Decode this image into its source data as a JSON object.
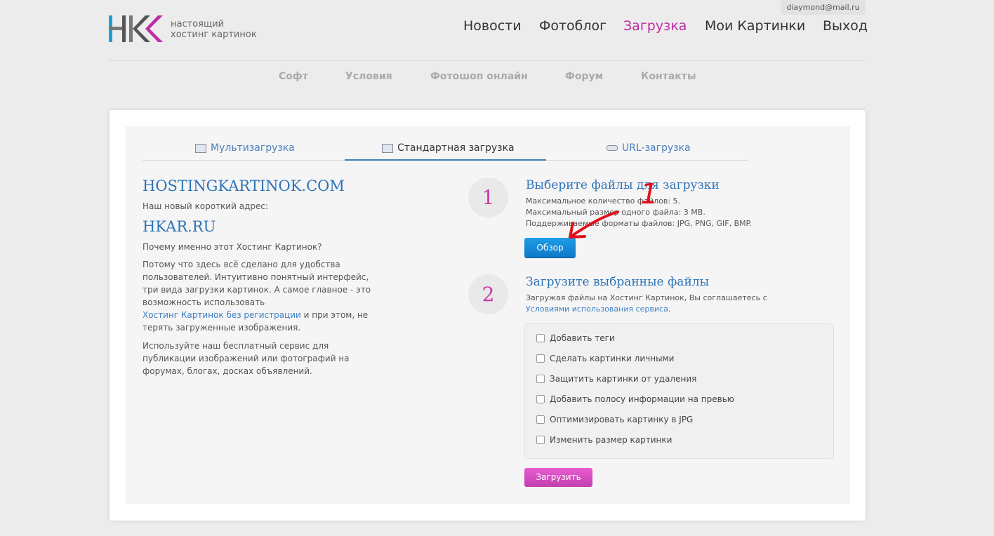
{
  "header": {
    "user_email": "diaymond@mail.ru",
    "tagline_line1": "настоящий",
    "tagline_line2": "хостинг картинок",
    "main_nav": [
      {
        "label": "Новости"
      },
      {
        "label": "Фотоблог"
      },
      {
        "label": "Загрузка"
      },
      {
        "label": "Мои Картинки"
      },
      {
        "label": "Выход"
      }
    ],
    "sub_nav": [
      {
        "label": "Софт"
      },
      {
        "label": "Условия"
      },
      {
        "label": "Фотошоп онлайн"
      },
      {
        "label": "Форум"
      },
      {
        "label": "Контакты"
      }
    ],
    "active_color": "#c02ca5"
  },
  "tabs": [
    {
      "label": "Мультизагрузка"
    },
    {
      "label": "Стандартная загрузка"
    },
    {
      "label": "URL-загрузка"
    }
  ],
  "left": {
    "site_name": "HOSTINGKARTINOK.COM",
    "short_address_label": "Наш новый короткий адрес:",
    "short_name": "HKAR.RU",
    "why_question": "Почему именно этот Хостинг Картинок?",
    "para1_line1": "Потому что здесь всё сделано для удобства",
    "para1_line2": "пользователей. Интуитивно понятный интерфейс,",
    "para1_line3": "три вида загрузки картинок. А самое главное - это",
    "para1_line4": "возможность использовать",
    "para1_link": "Хостинг Картинок без регистрации",
    "para1_after_link": " и при этом, не",
    "para1_line6": "терять загруженные изображения.",
    "para2_line1": "Используйте наш бесплатный сервис для",
    "para2_line2": "публикации изображений или фотографий на",
    "para2_line3": "форумах, блогах, досках объявлений."
  },
  "step1": {
    "number": "1",
    "title": "Выберите файлы для загрузки",
    "max_files": "Максимальное количество файлов: 5.",
    "max_size": "Максимальный размер одного файла: 3 MB.",
    "formats": "Поддерживаемые форматы файлов: JPG, PNG, GIF, BMP.",
    "browse_button": "Обзор"
  },
  "step2": {
    "number": "2",
    "title": "Загрузите выбранные файлы",
    "agree_text": "Загружая файлы на Хостинг Картинок, Вы соглашаетесь с",
    "terms_link": "Условиями использования сервиса",
    "terms_after": ".",
    "options": [
      {
        "label": "Добавить теги",
        "checked": false
      },
      {
        "label": "Сделать картинки личными",
        "checked": false
      },
      {
        "label": "Защитить картинки от удаления",
        "checked": false
      },
      {
        "label": "Добавить полосу информации на превью",
        "checked": false
      },
      {
        "label": "Оптимизировать картинку в JPG",
        "checked": false
      },
      {
        "label": "Изменить размер картинки",
        "checked": false
      }
    ],
    "upload_button": "Загрузить"
  },
  "annotation_number": "1"
}
